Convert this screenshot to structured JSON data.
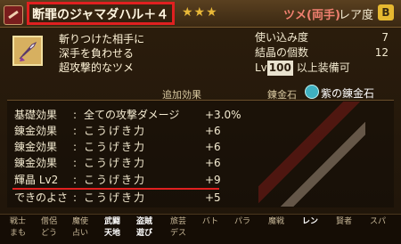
{
  "header": {
    "item_name": "断罪のジャマダハル＋４",
    "stars": "★★★",
    "category": "ツメ(両手)",
    "rarity_label": "レア度",
    "rarity_grade": "B"
  },
  "description": [
    "斬りつけた相手に",
    "深手を負わせる",
    "超攻撃的なツメ"
  ],
  "stats": {
    "use_label": "使い込み度",
    "use_value": "7",
    "crystal_label": "結晶の個数",
    "crystal_value": "12",
    "level_prefix": "Lv",
    "level_value": "100",
    "level_suffix": "以上装備可"
  },
  "section": {
    "additional_effects": "追加効果",
    "alchemy_stone_label": "錬金石",
    "alchemy_stone_name": "紫の錬金石"
  },
  "effects": [
    {
      "label": "基礎効果",
      "colon": ":",
      "text": "全ての攻撃ダメージ",
      "value": "+3.0%"
    },
    {
      "label": "錬金効果",
      "colon": ":",
      "text": "こうげき力",
      "value": "+6"
    },
    {
      "label": "錬金効果",
      "colon": ":",
      "text": "こうげき力",
      "value": "+6"
    },
    {
      "label": "錬金効果",
      "colon": ":",
      "text": "こうげき力",
      "value": "+6"
    },
    {
      "label": "輝晶 Lv2",
      "colon": ":",
      "text": "こうげき力",
      "value": "+9"
    },
    {
      "label": "できのよさ",
      "colon": ":",
      "text": "こうげき力",
      "value": "+5"
    }
  ],
  "tabs": [
    {
      "top": "戦士",
      "bottom": "まも"
    },
    {
      "top": "僧侶",
      "bottom": "どう"
    },
    {
      "top": "魔使",
      "bottom": "占い"
    },
    {
      "top": "武闘",
      "bottom": "天地"
    },
    {
      "top": "盗賊",
      "bottom": "遊び"
    },
    {
      "top": "旅芸",
      "bottom": "デス"
    },
    {
      "top": "バト",
      "bottom": ""
    },
    {
      "top": "パラ",
      "bottom": ""
    },
    {
      "top": "魔戦",
      "bottom": ""
    },
    {
      "top": "レン",
      "bottom": ""
    },
    {
      "top": "賢者",
      "bottom": ""
    },
    {
      "top": "スパ",
      "bottom": ""
    }
  ]
}
